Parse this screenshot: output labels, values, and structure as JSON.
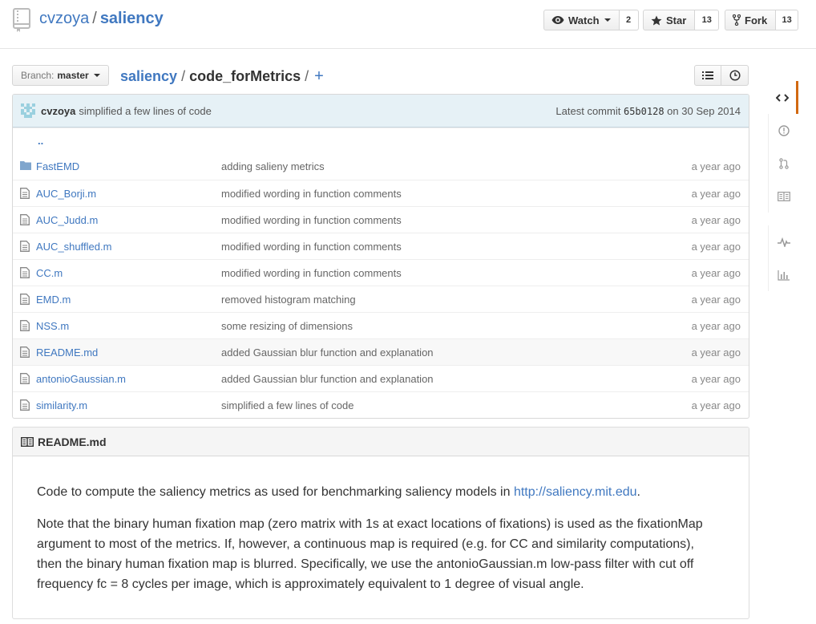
{
  "repo": {
    "owner": "cvzoya",
    "separator": "/",
    "name": "saliency"
  },
  "actions": {
    "watch": {
      "label": "Watch",
      "count": "2"
    },
    "star": {
      "label": "Star",
      "count": "13"
    },
    "fork": {
      "label": "Fork",
      "count": "13"
    }
  },
  "branch": {
    "prefix": "Branch:",
    "name": "master"
  },
  "breadcrumb": {
    "root": "saliency",
    "sep": "/",
    "current": "code_forMetrics",
    "sep2": "/",
    "add": "+"
  },
  "commit": {
    "author": "cvzoya",
    "message": "simplified a few lines of code",
    "latest_label": "Latest commit",
    "sha": "65b0128",
    "date_prefix": "on",
    "date": "30 Sep 2014"
  },
  "up_link": "..",
  "files": [
    {
      "name": "FastEMD",
      "type": "folder",
      "message": "adding salieny metrics",
      "age": "a year ago"
    },
    {
      "name": "AUC_Borji.m",
      "type": "file",
      "message": "modified wording in function comments",
      "age": "a year ago"
    },
    {
      "name": "AUC_Judd.m",
      "type": "file",
      "message": "modified wording in function comments",
      "age": "a year ago"
    },
    {
      "name": "AUC_shuffled.m",
      "type": "file",
      "message": "modified wording in function comments",
      "age": "a year ago"
    },
    {
      "name": "CC.m",
      "type": "file",
      "message": "modified wording in function comments",
      "age": "a year ago"
    },
    {
      "name": "EMD.m",
      "type": "file",
      "message": "removed histogram matching",
      "age": "a year ago"
    },
    {
      "name": "NSS.m",
      "type": "file",
      "message": "some resizing of dimensions",
      "age": "a year ago"
    },
    {
      "name": "README.md",
      "type": "file",
      "message": "added Gaussian blur function and explanation",
      "age": "a year ago"
    },
    {
      "name": "antonioGaussian.m",
      "type": "file",
      "message": "added Gaussian blur function and explanation",
      "age": "a year ago"
    },
    {
      "name": "similarity.m",
      "type": "file",
      "message": "simplified a few lines of code",
      "age": "a year ago"
    }
  ],
  "readme": {
    "title": "README.md",
    "p1_text": "Code to compute the saliency metrics as used for benchmarking saliency models in ",
    "p1_link": "http://saliency.mit.edu",
    "p1_end": ".",
    "p2_line1": "Note that the binary human fixation map (zero matrix with 1s at exact locations of fixations) is used as the fixationMap",
    "p2_line2": "argument to most of the metrics. If, however, a continuous map is required (e.g. for CC and similarity computations),",
    "p2_line3": "then the binary human fixation map is blurred. Specifically, we use the antonioGaussian.m low-pass filter with cut off",
    "p2_line4": "frequency fc = 8 cycles per image, which is approximately equivalent to 1 degree of visual angle."
  },
  "colors": {
    "link": "#4078c0",
    "commit_bg": "#e6f1f6",
    "active_tab": "#d26911"
  }
}
